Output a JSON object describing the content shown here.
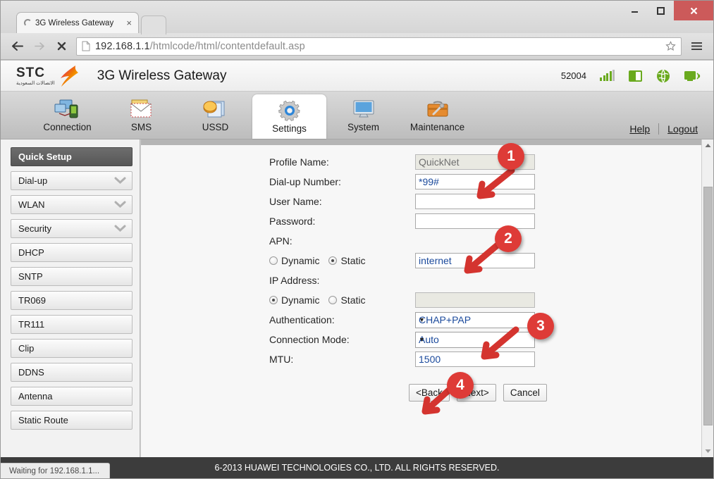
{
  "browser": {
    "tab_title": "3G Wireless Gateway",
    "tab_close": "×",
    "url_host": "192.168.1.1",
    "url_path": "/htmlcode/html/contentdefault.asp",
    "status_text": "Waiting for 192.168.1.1..."
  },
  "site": {
    "logo_word": "STC",
    "logo_arabic": "الاتصالات السعودية",
    "title": "3G Wireless Gateway",
    "imei": "52004",
    "footer": "6-2013 HUAWEI TECHNOLOGIES CO., LTD. ALL RIGHTS RESERVED.",
    "signal_icon": "signal-bars-icon",
    "sim_icon": "sim-card-icon",
    "globe_icon": "globe-icon",
    "wifi_icon": "wifi-monitor-icon"
  },
  "nav": {
    "items": [
      {
        "label": "Connection",
        "icon": "connection-icon",
        "active": false
      },
      {
        "label": "SMS",
        "icon": "envelope-icon",
        "active": false
      },
      {
        "label": "USSD",
        "icon": "ussd-icon",
        "active": false
      },
      {
        "label": "Settings",
        "icon": "gear-icon",
        "active": true
      },
      {
        "label": "System",
        "icon": "monitor-icon",
        "active": false
      },
      {
        "label": "Maintenance",
        "icon": "toolbox-icon",
        "active": false
      }
    ],
    "help": "Help",
    "logout": "Logout"
  },
  "sidebar": {
    "items": [
      {
        "label": "Quick Setup",
        "active": true,
        "chevron": false
      },
      {
        "label": "Dial-up",
        "active": false,
        "chevron": true
      },
      {
        "label": "WLAN",
        "active": false,
        "chevron": true
      },
      {
        "label": "Security",
        "active": false,
        "chevron": true
      },
      {
        "label": "DHCP",
        "active": false,
        "chevron": false
      },
      {
        "label": "SNTP",
        "active": false,
        "chevron": false
      },
      {
        "label": "TR069",
        "active": false,
        "chevron": false
      },
      {
        "label": "TR111",
        "active": false,
        "chevron": false
      },
      {
        "label": "Clip",
        "active": false,
        "chevron": false
      },
      {
        "label": "DDNS",
        "active": false,
        "chevron": false
      },
      {
        "label": "Antenna",
        "active": false,
        "chevron": false
      },
      {
        "label": "Static Route",
        "active": false,
        "chevron": false
      }
    ]
  },
  "form": {
    "profile_name_label": "Profile Name:",
    "profile_name_value": "QuickNet",
    "dialup_label": "Dial-up Number:",
    "dialup_value": "*99#",
    "username_label": "User Name:",
    "username_value": "",
    "password_label": "Password:",
    "password_value": "",
    "apn_label": "APN:",
    "apn_dynamic_label": "Dynamic",
    "apn_static_label": "Static",
    "apn_selected": "Static",
    "apn_value": "internet",
    "ip_label": "IP Address:",
    "ip_dynamic_label": "Dynamic",
    "ip_static_label": "Static",
    "ip_selected": "Dynamic",
    "ip_value": "",
    "auth_label": "Authentication:",
    "auth_value": "CHAP+PAP",
    "connmode_label": "Connection Mode:",
    "connmode_value": "Auto",
    "mtu_label": "MTU:",
    "mtu_value": "1500",
    "back_button": "<Back",
    "next_button": "Next>",
    "cancel_button": "Cancel"
  },
  "annotations": [
    {
      "number": "1",
      "target": "dialup-number-field"
    },
    {
      "number": "2",
      "target": "apn-value-field"
    },
    {
      "number": "3",
      "target": "connection-mode-select"
    },
    {
      "number": "4",
      "target": "next-button"
    }
  ],
  "colors": {
    "badge_red": "#de3b37",
    "accent_green": "#6aaa1e",
    "footer_dark": "#3c3c3c",
    "field_text_blue": "#1b4a9c"
  }
}
